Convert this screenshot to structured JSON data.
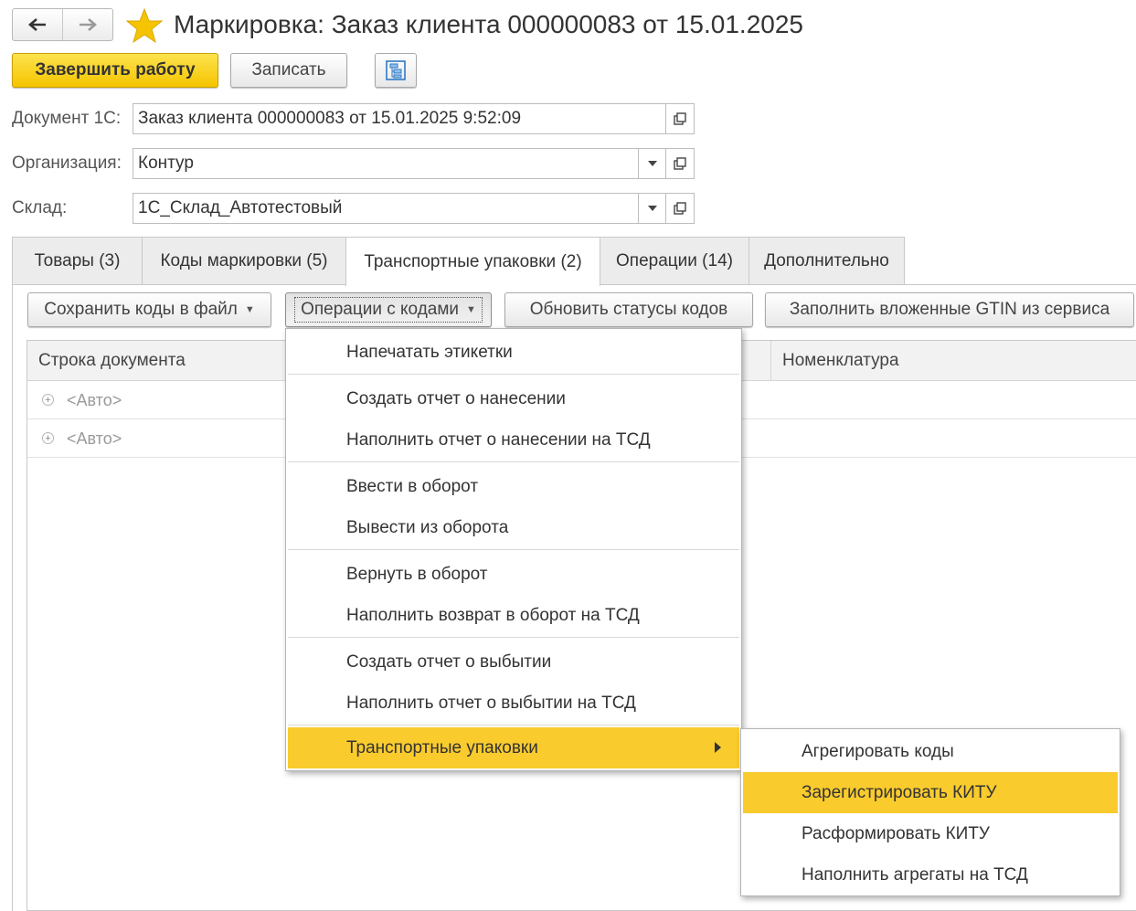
{
  "window": {
    "title": "Маркировка: Заказ клиента 000000083 от 15.01.2025",
    "nav_back_icon": "arrow-left-icon",
    "nav_forward_icon": "arrow-right-icon",
    "favorite_icon": "star-icon",
    "accent_color": "#f5c400"
  },
  "toolbar": {
    "finish_label": "Завершить работу",
    "save_label": "Записать",
    "structure_icon": "document-structure-icon"
  },
  "form": {
    "document_label": "Документ 1С:",
    "document_value": "Заказ клиента 000000083 от 15.01.2025 9:52:09",
    "organization_label": "Организация:",
    "organization_value": "Контур",
    "warehouse_label": "Склад:",
    "warehouse_value": "1С_Склад_Автотестовый"
  },
  "tabs": [
    {
      "label": "Товары (3)"
    },
    {
      "label": "Коды маркировки (5)"
    },
    {
      "label": "Транспортные упаковки (2)",
      "active": true
    },
    {
      "label": "Операции (14)"
    },
    {
      "label": "Дополнительно"
    }
  ],
  "commands": {
    "save_codes": "Сохранить коды в файл",
    "code_operations": "Операции с кодами",
    "refresh_statuses": "Обновить статусы кодов",
    "fill_gtin": "Заполнить вложенные GTIN из сервиса"
  },
  "table": {
    "columns": [
      "Строка документа",
      "Номенклатура"
    ],
    "rows": [
      {
        "document_line": "<Авто>"
      },
      {
        "document_line": "<Авто>"
      }
    ]
  },
  "menu": {
    "items": [
      "Напечатать этикетки",
      "Создать отчет о нанесении",
      "Наполнить отчет о нанесении на ТСД",
      "Ввести в оборот",
      "Вывести из оборота",
      "Вернуть в оборот",
      "Наполнить возврат в оборот на ТСД",
      "Создать отчет о выбытии",
      "Наполнить отчет о выбытии на ТСД",
      "Транспортные упаковки"
    ],
    "highlight_color": "#f9cb2d"
  },
  "submenu": {
    "items": [
      "Агрегировать коды",
      "Зарегистрировать КИТУ",
      "Расформировать КИТУ",
      "Наполнить агрегаты на ТСД"
    ]
  }
}
